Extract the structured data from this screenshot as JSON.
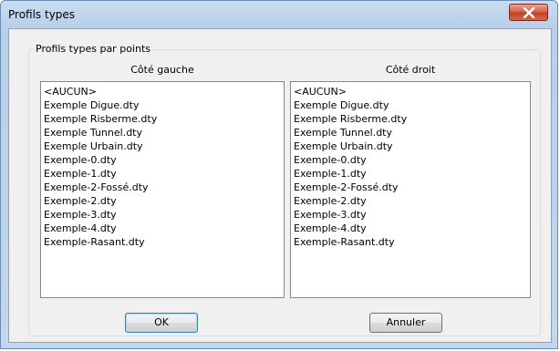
{
  "window": {
    "title": "Profils types",
    "close_icon": "close-icon"
  },
  "group": {
    "caption": "Profils types par points"
  },
  "left": {
    "header": "Côté gauche",
    "items": [
      "<AUCUN>",
      "Exemple Digue.dty",
      "Exemple Risberme.dty",
      "Exemple Tunnel.dty",
      "Exemple Urbain.dty",
      "Exemple-0.dty",
      "Exemple-1.dty",
      "Exemple-2-Fossé.dty",
      "Exemple-2.dty",
      "Exemple-3.dty",
      "Exemple-4.dty",
      "Exemple-Rasant.dty"
    ]
  },
  "right": {
    "header": "Côté droit",
    "items": [
      "<AUCUN>",
      "Exemple Digue.dty",
      "Exemple Risberme.dty",
      "Exemple Tunnel.dty",
      "Exemple Urbain.dty",
      "Exemple-0.dty",
      "Exemple-1.dty",
      "Exemple-2-Fossé.dty",
      "Exemple-2.dty",
      "Exemple-3.dty",
      "Exemple-4.dty",
      "Exemple-Rasant.dty"
    ]
  },
  "buttons": {
    "ok": "OK",
    "cancel": "Annuler"
  }
}
